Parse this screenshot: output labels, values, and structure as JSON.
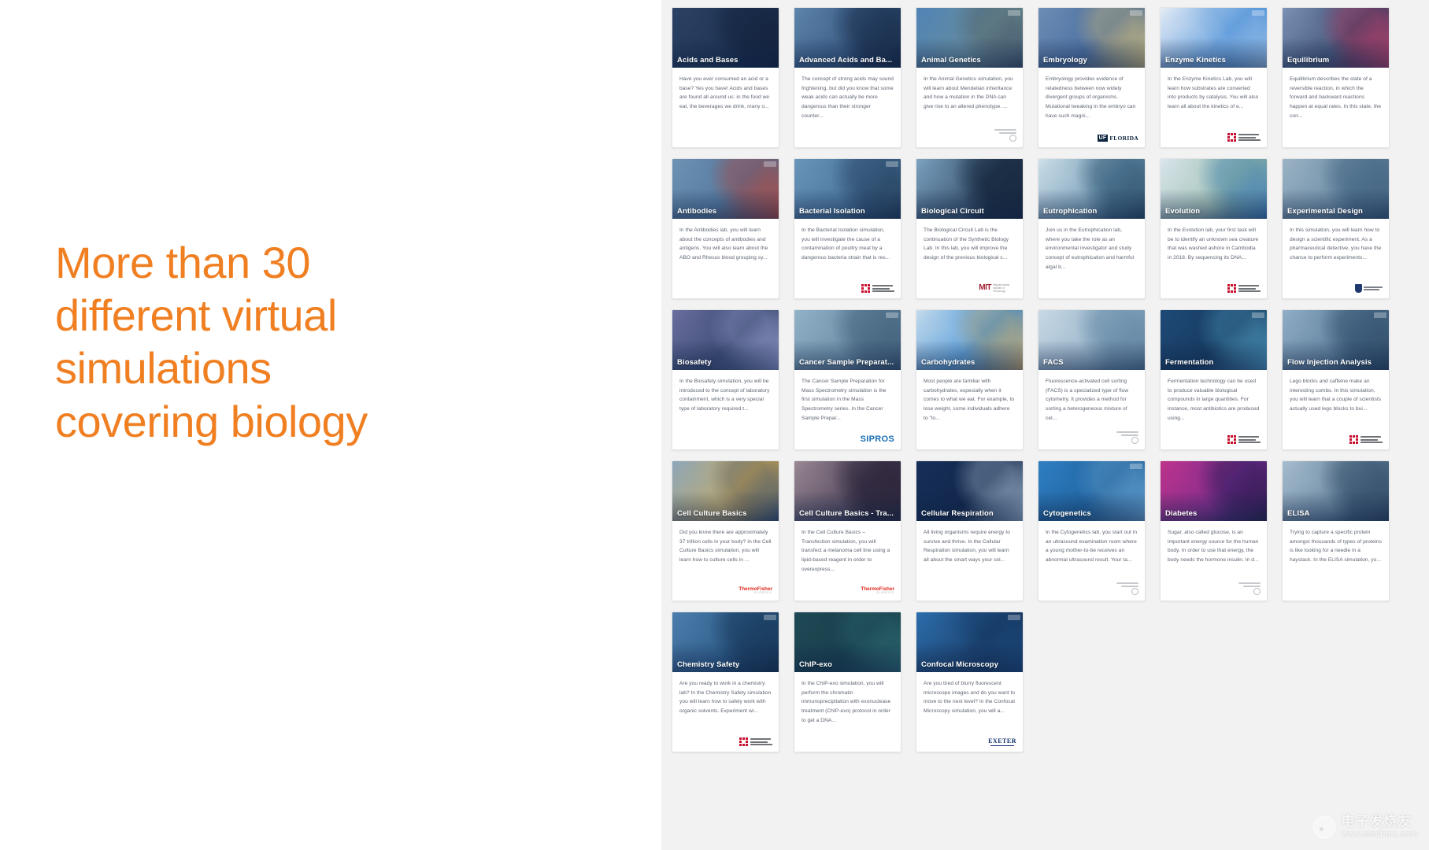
{
  "headline": "More than 30\ndifferent virtual\nsimulations\ncovering biology",
  "accent_color": "#f07f22",
  "panel_background": "#f2f2f2",
  "watermark": {
    "cn_text": "电子发烧友",
    "url": "www.elecfans.com"
  },
  "cards": [
    {
      "title": "Acids and Bases",
      "description": "Have you ever consumed an acid or a base? Yes you have! Acids and bases are found all around us: in the food we eat, the beverages we drink, many o...",
      "logo": "none",
      "thumb_colors": [
        "#2c4365",
        "#1b2f4e",
        "#12203a"
      ],
      "has_badge": false
    },
    {
      "title": "Advanced Acids and Ba...",
      "description": "The concept of strong acids may sound frightening, but did you know that some weak acids can actually be more dangerous than their stronger counter...",
      "logo": "none",
      "thumb_colors": [
        "#5f86ae",
        "#2b4a72",
        "#16263f"
      ],
      "has_badge": false
    },
    {
      "title": "Animal Genetics",
      "description": "In the Animal Genetics simulation, you will learn about Mendelian inheritance and how a mutation in the DNA can give rise to an altered phenotype. ...",
      "logo": "generic",
      "thumb_colors": [
        "#4f83b8",
        "#6f8f92",
        "#41556b"
      ],
      "has_badge": true
    },
    {
      "title": "Embryology",
      "description": "Embryology provides evidence of relatedness between now widely divergent groups of organisms. Mutational tweaking in the embryo can have such magni...",
      "logo": "uf",
      "thumb_colors": [
        "#6d8eb4",
        "#3f639a",
        "#d8c27a"
      ],
      "has_badge": true
    },
    {
      "title": "Enzyme Kinetics",
      "description": "In the Enzyme Kinetics Lab, you will learn how substrates are converted into products by catalysis. You will also learn all about the kinetics of e...",
      "logo": "dtu",
      "thumb_colors": [
        "#e8eef6",
        "#3d87d6",
        "#9fc2e6"
      ],
      "has_badge": true
    },
    {
      "title": "Equilibrium",
      "description": "Equilibrium describes the state of a reversible reaction, in which the forward and backward reactions happen at equal rates. In this state, the con...",
      "logo": "none",
      "thumb_colors": [
        "#7d93b6",
        "#2e3f63",
        "#c4406a"
      ],
      "has_badge": false
    },
    {
      "title": "Antibodies",
      "description": "In the Antibodies lab, you will learn about the concepts of antibodies and antigens. You will also learn about the ABO and Rhesus blood grouping sy...",
      "logo": "none",
      "thumb_colors": [
        "#6f93b4",
        "#4a6f95",
        "#b9483e"
      ],
      "has_badge": true
    },
    {
      "title": "Bacterial Isolation",
      "description": "In the Bacterial Isolation simulation, you will investigate the cause of a contamination of poultry meat by a dangerous bacteria strain that is res...",
      "logo": "dtu",
      "thumb_colors": [
        "#6b96bc",
        "#3d6990",
        "#253c58"
      ],
      "has_badge": true
    },
    {
      "title": "Biological Circuit",
      "description": "The Biological Circuit Lab is the continuation of the Synthetic Biology Lab. In this lab, you will improve the design of the previous biological c...",
      "logo": "mit",
      "thumb_colors": [
        "#7da5c4",
        "#21364f",
        "#15253a"
      ],
      "has_badge": false
    },
    {
      "title": "Eutrophication",
      "description": "Join us in the Eutrophication lab, where you take the role as an environmental investigator and study concept of eutrophication and harmful algal b...",
      "logo": "none",
      "thumb_colors": [
        "#cfe0ea",
        "#5d8aa8",
        "#2b4c66"
      ],
      "has_badge": false
    },
    {
      "title": "Evolution",
      "description": "In the Evolution lab, your first task will be to identify an unknown sea creature that was washed ashore in Cambodia in 2018. By sequencing its DNA...",
      "logo": "dtu",
      "thumb_colors": [
        "#dbe6ee",
        "#8fb6a2",
        "#3d7ab8"
      ],
      "has_badge": false
    },
    {
      "title": "Experimental Design",
      "description": "In this simulation, you will learn how to design a scientific experiment. As a pharmaceutical detective, you have the chance to perform experiments...",
      "logo": "adelaide",
      "thumb_colors": [
        "#9db5c6",
        "#5c7e99",
        "#3f5f7d"
      ],
      "has_badge": false
    },
    {
      "title": "Biosafety",
      "description": "In the Biosafety simulation, you will be introduced to the concept of laboratory containment, which is a very special type of laboratory required t...",
      "logo": "none",
      "thumb_colors": [
        "#6b6fa0",
        "#2c3f63",
        "#9a9fd0"
      ],
      "has_badge": false
    },
    {
      "title": "Cancer Sample Preparat...",
      "description": "The Cancer Sample Preparation for Mass Spectrometry simulation is the first simulation in the Mass Spectrometry series. In the Cancer Sample Prepar...",
      "logo": "sipros",
      "thumb_colors": [
        "#93b3c9",
        "#5e8099",
        "#3d5a75"
      ],
      "has_badge": true
    },
    {
      "title": "Carbohydrates",
      "description": "Most people are familiar with carbohydrates, especially when it comes to what we eat. For example, to lose weight, some individuals adhere to \"lo...",
      "logo": "none",
      "thumb_colors": [
        "#c7dced",
        "#2f86d1",
        "#d8b06a"
      ],
      "has_badge": false
    },
    {
      "title": "FACS",
      "description": "Fluorescence-activated cell sorting (FACS) is a specialized type of flow cytometry. It provides a method for sorting a heterogeneous mixture of cel...",
      "logo": "generic",
      "thumb_colors": [
        "#cadae6",
        "#87a8c0",
        "#5b7e9c"
      ],
      "has_badge": false
    },
    {
      "title": "Fermentation",
      "description": "Fermentation technology can be used to produce valuable biological compounds in large quantities. For instance, most antibiotics are produced using...",
      "logo": "dtu",
      "thumb_colors": [
        "#1f4a78",
        "#123455",
        "#4f9ac2"
      ],
      "has_badge": true
    },
    {
      "title": "Flow Injection Analysis",
      "description": "Lego blocks and caffeine make an interesting combo. In this simulation, you will learn that a couple of scientists actually used lego blocks to bui...",
      "logo": "dtu",
      "thumb_colors": [
        "#93b0c8",
        "#4c6e8c",
        "#2e4a66"
      ],
      "has_badge": true
    },
    {
      "title": "Cell Culture Basics",
      "description": "Did you know there are approximately 37 trillion cells in your body? In the Cell Culture Basics simulation, you will learn how to culture cells in ...",
      "logo": "thermo",
      "thumb_colors": [
        "#8ba7bd",
        "#d2a84f",
        "#3a5270"
      ],
      "has_badge": false
    },
    {
      "title": "Cell Culture Basics - Tra...",
      "description": "In the Cell Culture Basics – Transfection simulation, you will transfect a melanoma cell line using a lipid-based reagent in order to overexpress...",
      "logo": "thermo",
      "thumb_colors": [
        "#9c8a96",
        "#3a3148",
        "#2a2438"
      ],
      "has_badge": false
    },
    {
      "title": "Cellular Respiration",
      "description": "All living organisms require energy to survive and thrive. In the Cellular Respiration simulation, you will learn all about the smart ways your cel...",
      "logo": "none",
      "thumb_colors": [
        "#17305a",
        "#0f2243",
        "#9fb7cf"
      ],
      "has_badge": false
    },
    {
      "title": "Cytogenetics",
      "description": "In the Cytogenetics lab, you start out in an ultrasound examination room where a young mother-to-be receives an abnormal ultrasound result. Your ta...",
      "logo": "generic",
      "thumb_colors": [
        "#2f7fc4",
        "#1b5a92",
        "#6aa8d8"
      ],
      "has_badge": true
    },
    {
      "title": "Diabetes",
      "description": "Sugar, also called glucose, is an important energy source for the human body. In order to use that energy, the body needs the hormone insulin. In d...",
      "logo": "generic",
      "thumb_colors": [
        "#c0348c",
        "#6a2a8f",
        "#2a1a46"
      ],
      "has_badge": false
    },
    {
      "title": "ELISA",
      "description": "Trying to capture a specific protein amongst thousands of types of proteins is like looking for a needle in a haystack. In the ELISA simulation, yo...",
      "logo": "none",
      "thumb_colors": [
        "#a8bfd0",
        "#56748f",
        "#2d4660"
      ],
      "has_badge": false
    },
    {
      "title": "Chemistry Safety",
      "description": "Are you ready to work in a chemistry lab? In the Chemistry Safety simulation you will learn how to safely work with organic solvents. Experiment wi...",
      "logo": "dtu",
      "thumb_colors": [
        "#4d7fae",
        "#23507c",
        "#16324f"
      ],
      "has_badge": true
    },
    {
      "title": "ChIP-exo",
      "description": "In the ChIP-exo simulation, you will perform the chromatin immunoprecipitation with exonuclease treatment (ChIP-exo) protocol in order to get a DNA...",
      "logo": "none",
      "thumb_colors": [
        "#1f4a55",
        "#153a48",
        "#2e6b72"
      ],
      "has_badge": false
    },
    {
      "title": "Confocal Microscopy",
      "description": "Are you tired of blurry fluorescent microscope images and do you want to move to the next level? In the Confocal Microscopy simulation, you will a...",
      "logo": "exeter",
      "thumb_colors": [
        "#2d6fae",
        "#16335a",
        "#1b4a7e"
      ],
      "has_badge": true
    }
  ]
}
